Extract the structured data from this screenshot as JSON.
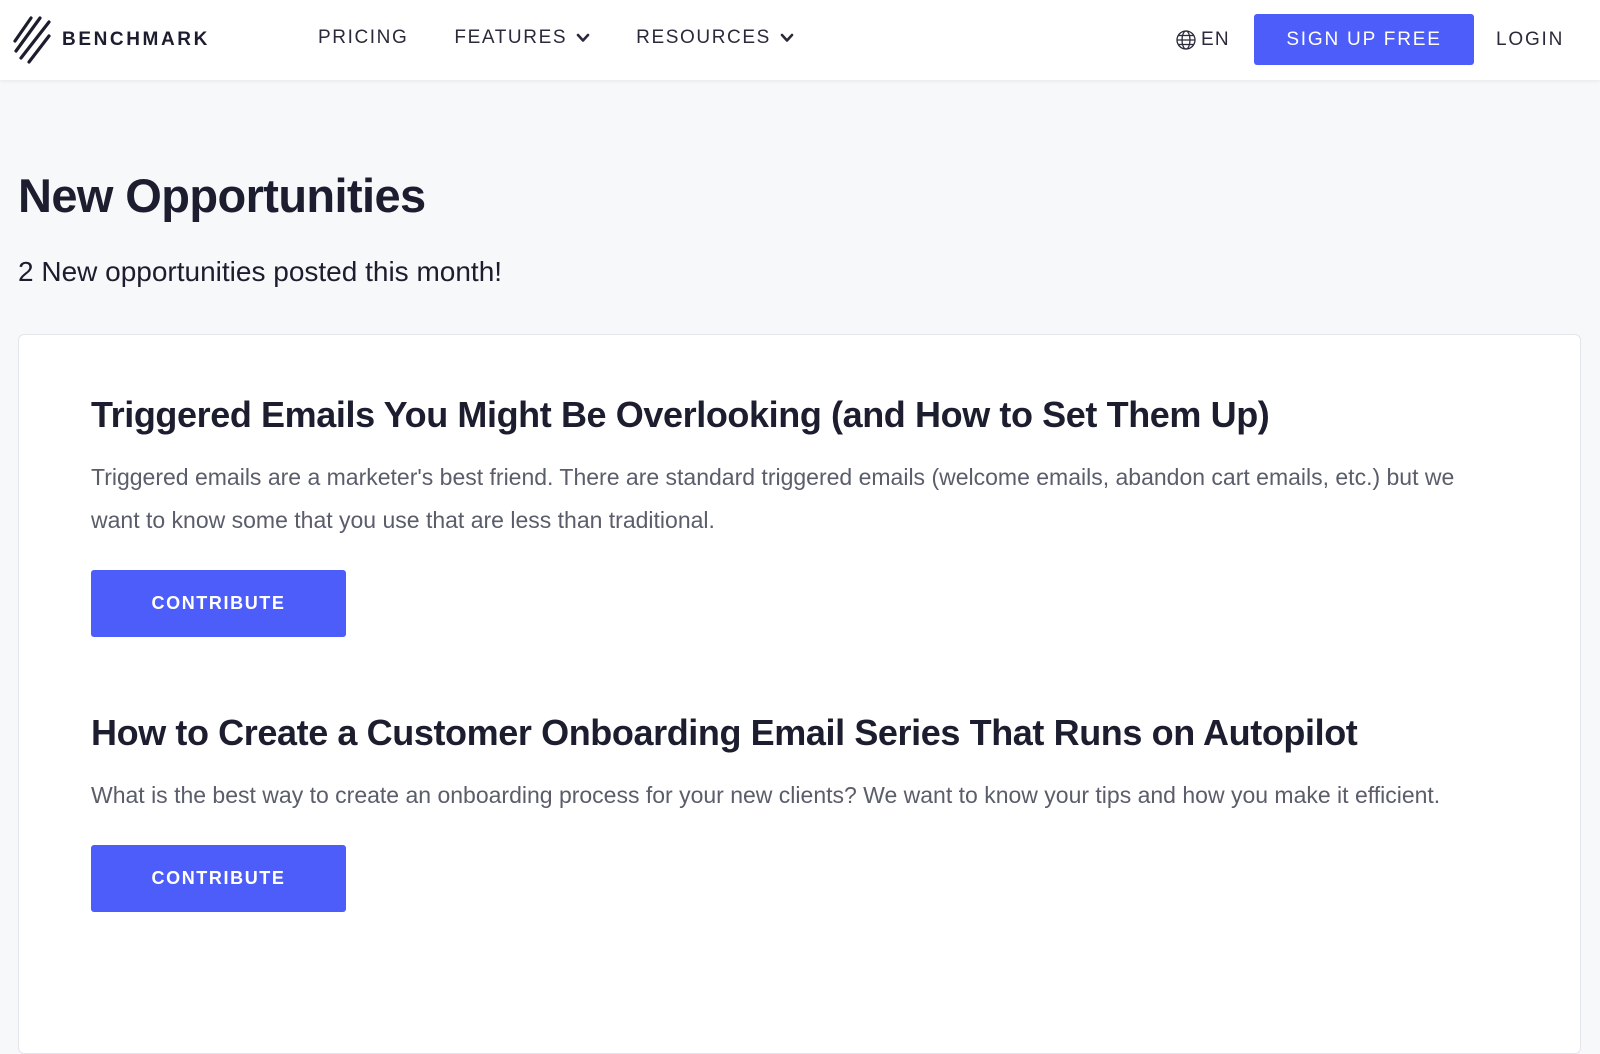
{
  "header": {
    "logo_text": "BENCHMARK",
    "nav": [
      {
        "label": "PRICING",
        "has_dropdown": false
      },
      {
        "label": "FEATURES",
        "has_dropdown": true
      },
      {
        "label": "RESOURCES",
        "has_dropdown": true
      }
    ],
    "language": "EN",
    "language_icon": "globe-icon",
    "signup_label": "SIGN UP FREE",
    "login_label": "LOGIN"
  },
  "main": {
    "title": "New Opportunities",
    "subtitle": "2 New opportunities posted this month!",
    "opportunities": [
      {
        "title": "Triggered Emails You Might Be Overlooking (and How to Set Them Up)",
        "description": "Triggered emails are a marketer's best friend. There are standard triggered emails (welcome emails, abandon cart emails, etc.) but we want to know some that you use that are less than traditional.",
        "button_label": "CONTRIBUTE"
      },
      {
        "title": "How to Create a Customer Onboarding Email Series That Runs on Autopilot",
        "description": "What is the best way to create an onboarding process for your new clients? We want to know your tips and how you make it efficient.",
        "button_label": "CONTRIBUTE"
      }
    ]
  },
  "colors": {
    "accent": "#4d5dfa",
    "text_dark": "#1c1d2e",
    "text_muted": "#5a5d6a",
    "page_background": "#f7f8fa",
    "card_background": "#ffffff"
  }
}
